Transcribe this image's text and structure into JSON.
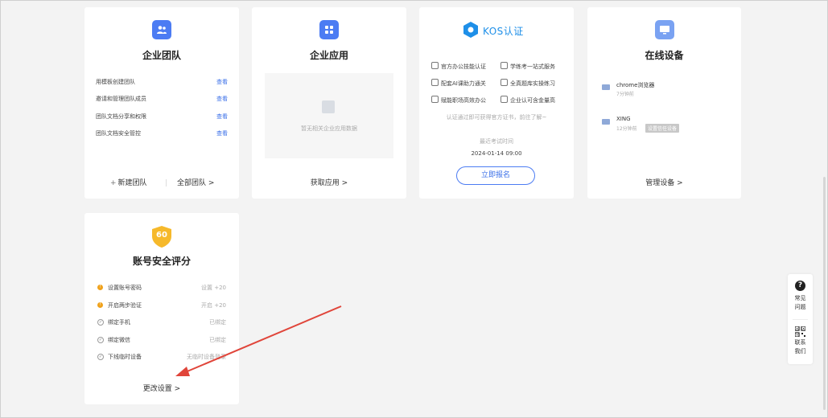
{
  "team_card": {
    "title": "企业团队",
    "icon": "team-icon",
    "rows": [
      {
        "text": "用模板创建团队",
        "link": "查看"
      },
      {
        "text": "邀请和管理团队成员",
        "link": "查看"
      },
      {
        "text": "团队文档分享和权限",
        "link": "查看"
      },
      {
        "text": "团队文档安全管控",
        "link": "查看"
      }
    ],
    "new_team": "新建团队",
    "all_teams": "全部团队 >"
  },
  "apps_card": {
    "title": "企业应用",
    "icon": "apps-grid-icon",
    "empty_text": "暂无相关企业应用数据",
    "footer": "获取应用 >"
  },
  "kos_card": {
    "logo_text": "KOS认证",
    "features": [
      "官方办公技能认证",
      "学练考一站式服务",
      "配套AI课助力通关",
      "全真题库实操练习",
      "赋能职场高效办公",
      "企业认可含金量高"
    ],
    "desc": "认证通过即可获得官方证书，前往了解~",
    "exam_label": "最近考试时间",
    "exam_date": "2024-01-14 09:00",
    "cta": "立即报名"
  },
  "device_card": {
    "title": "在线设备",
    "icon": "monitor-icon",
    "devices": [
      {
        "name": "chrome浏览器",
        "time": "7分钟前",
        "badge": ""
      },
      {
        "name": "XING",
        "time": "12分钟前",
        "badge": "设置信任设备"
      }
    ],
    "footer": "管理设备 >"
  },
  "security_card": {
    "score": "60",
    "title": "账号安全评分",
    "rows": [
      {
        "text": "设置账号密码",
        "status": "设置 +20",
        "state": "warn"
      },
      {
        "text": "开启两步验证",
        "status": "开启 +20",
        "state": "warn"
      },
      {
        "text": "绑定手机",
        "status": "已绑定",
        "state": "ok"
      },
      {
        "text": "绑定微信",
        "status": "已绑定",
        "state": "ok"
      },
      {
        "text": "下线临时设备",
        "status": "无临时设备登录",
        "state": "ok"
      }
    ],
    "footer": "更改设置 >"
  },
  "helper": {
    "faq_l1": "常见",
    "faq_l2": "问题",
    "contact_l1": "联系",
    "contact_l2": "我们"
  },
  "colors": {
    "accent": "#4c7cf3",
    "link": "#3a6fe8",
    "warn": "#f0a21c",
    "arrow": "#e0453a"
  }
}
